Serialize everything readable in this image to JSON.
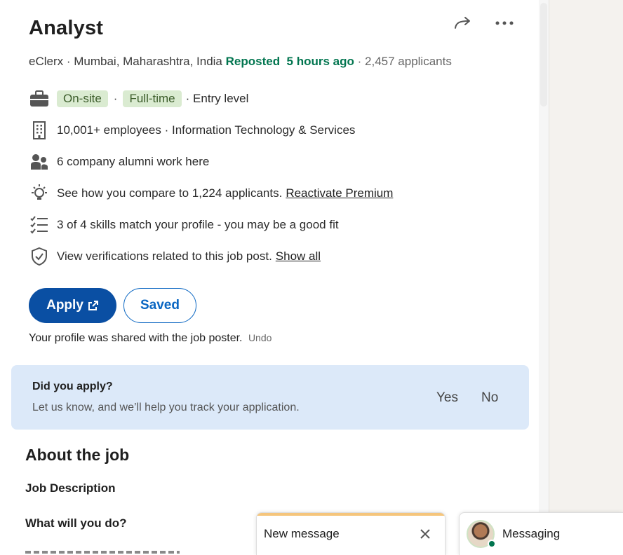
{
  "job": {
    "title": "Analyst",
    "company": "eClerx",
    "location": "Mumbai, Maharashtra, India",
    "reposted_label": "Reposted",
    "time_ago": "5 hours ago",
    "applicants": "2,457 applicants"
  },
  "insights": {
    "workplace": "On-site",
    "job_type": "Full-time",
    "level": "· Entry level",
    "company_size": "10,001+ employees · Information Technology & Services",
    "alumni": "6 company alumni work here",
    "compare_text": "See how you compare to 1,224 applicants.",
    "premium_link": "Reactivate Premium",
    "skills": "3 of 4 skills match your profile - you may be a good fit",
    "verifications_text": "View verifications related to this job post.",
    "show_all_link": "Show all"
  },
  "actions": {
    "apply_label": "Apply",
    "saved_label": "Saved",
    "shared_message": "Your profile was shared with the job poster.",
    "undo_label": "Undo"
  },
  "applied_prompt": {
    "question": "Did you apply?",
    "subtext": "Let us know, and we’ll help you track your application.",
    "yes_label": "Yes",
    "no_label": "No"
  },
  "about": {
    "heading": "About the job",
    "section1": "Job Description",
    "section2": "What will you do?"
  },
  "chat": {
    "new_message_label": "New message",
    "messaging_label": "Messaging"
  },
  "icons": {
    "share": "share-arrow-icon",
    "more": "more-horizontal-icon",
    "briefcase": "briefcase-icon",
    "building": "building-icon",
    "people": "people-icon",
    "lightbulb": "lightbulb-icon",
    "checklist": "checklist-icon",
    "shield": "shield-check-icon",
    "external": "external-link-icon",
    "close": "close-icon"
  },
  "colors": {
    "primary": "#0a4fa3",
    "green": "#01754f",
    "pill_bg": "#daebd1",
    "card_bg": "#dce9f9"
  }
}
